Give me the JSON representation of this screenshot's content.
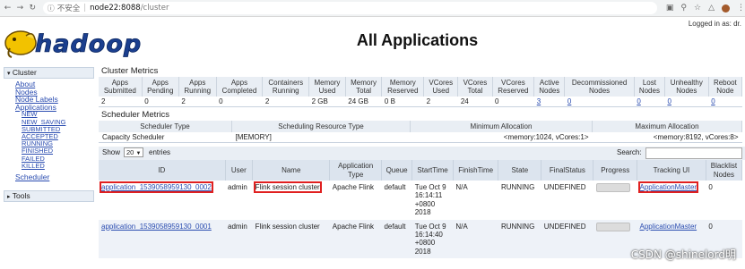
{
  "browser": {
    "security": "不安全",
    "url_host": "node22:8088",
    "url_path": "/cluster"
  },
  "header": {
    "title": "All Applications",
    "logged_in": "Logged in as: dr.",
    "logo_text": "hadoop"
  },
  "sidebar": {
    "cluster_label": "Cluster",
    "links": [
      "About",
      "Nodes",
      "Node Labels",
      "Applications"
    ],
    "states": [
      "NEW",
      "NEW_SAVING",
      "SUBMITTED",
      "ACCEPTED",
      "RUNNING",
      "FINISHED",
      "FAILED",
      "KILLED"
    ],
    "scheduler": "Scheduler",
    "tools_label": "Tools"
  },
  "cluster_metrics": {
    "title": "Cluster Metrics",
    "headers": [
      [
        "Apps",
        "Submitted"
      ],
      [
        "Apps",
        "Pending"
      ],
      [
        "Apps",
        "Running"
      ],
      [
        "Apps",
        "Completed"
      ],
      [
        "Containers",
        "Running"
      ],
      [
        "Memory",
        "Used"
      ],
      [
        "Memory",
        "Total"
      ],
      [
        "Memory",
        "Reserved"
      ],
      [
        "VCores",
        "Used"
      ],
      [
        "VCores",
        "Total"
      ],
      [
        "VCores",
        "Reserved"
      ],
      [
        "Active",
        "Nodes"
      ],
      [
        "Decommissioned",
        "Nodes"
      ],
      [
        "Lost",
        "Nodes"
      ],
      [
        "Unhealthy",
        "Nodes"
      ],
      [
        "Reboot",
        "Node"
      ]
    ],
    "values": [
      "2",
      "0",
      "2",
      "0",
      "2",
      "2 GB",
      "24 GB",
      "0 B",
      "2",
      "24",
      "0",
      "3",
      "0",
      "0",
      "0",
      "0"
    ]
  },
  "scheduler_metrics": {
    "title": "Scheduler Metrics",
    "headers": [
      "Scheduler Type",
      "Scheduling Resource Type",
      "Minimum Allocation",
      "Maximum Allocation"
    ],
    "values": [
      "Capacity Scheduler",
      "[MEMORY]",
      "<memory:1024, vCores:1>",
      "<memory:8192, vCores:8>"
    ]
  },
  "table_controls": {
    "show_label": "Show",
    "show_value": "20",
    "entries_label": "entries",
    "search_label": "Search:"
  },
  "apps_table": {
    "headers": [
      [
        "ID"
      ],
      [
        "User"
      ],
      [
        "Name"
      ],
      [
        "Application",
        "Type"
      ],
      [
        "Queue"
      ],
      [
        "StartTime"
      ],
      [
        "FinishTime"
      ],
      [
        "State"
      ],
      [
        "FinalStatus"
      ],
      [
        "Progress"
      ],
      [
        "Tracking UI"
      ],
      [
        "Blacklist",
        "Nodes"
      ]
    ],
    "rows": [
      {
        "id": "application_1539058959130_0002",
        "user": "admin",
        "name": "Flink session cluster",
        "type": "Apache Flink",
        "queue": "default",
        "start": [
          "Tue Oct 9",
          "16:14:11",
          "+0800",
          "2018"
        ],
        "finish": "N/A",
        "state": "RUNNING",
        "final_status": "UNDEFINED",
        "tracking": "ApplicationMaster",
        "blacklist": "0"
      },
      {
        "id": "application_1539058959130_0001",
        "user": "admin",
        "name": "Flink session cluster",
        "type": "Apache Flink",
        "queue": "default",
        "start": [
          "Tue Oct 9",
          "16:14:40",
          "+0800",
          "2018"
        ],
        "finish": "N/A",
        "state": "RUNNING",
        "final_status": "UNDEFINED",
        "tracking": "ApplicationMaster",
        "blacklist": "0"
      }
    ]
  },
  "watermark": "CSDN @shinelord明"
}
